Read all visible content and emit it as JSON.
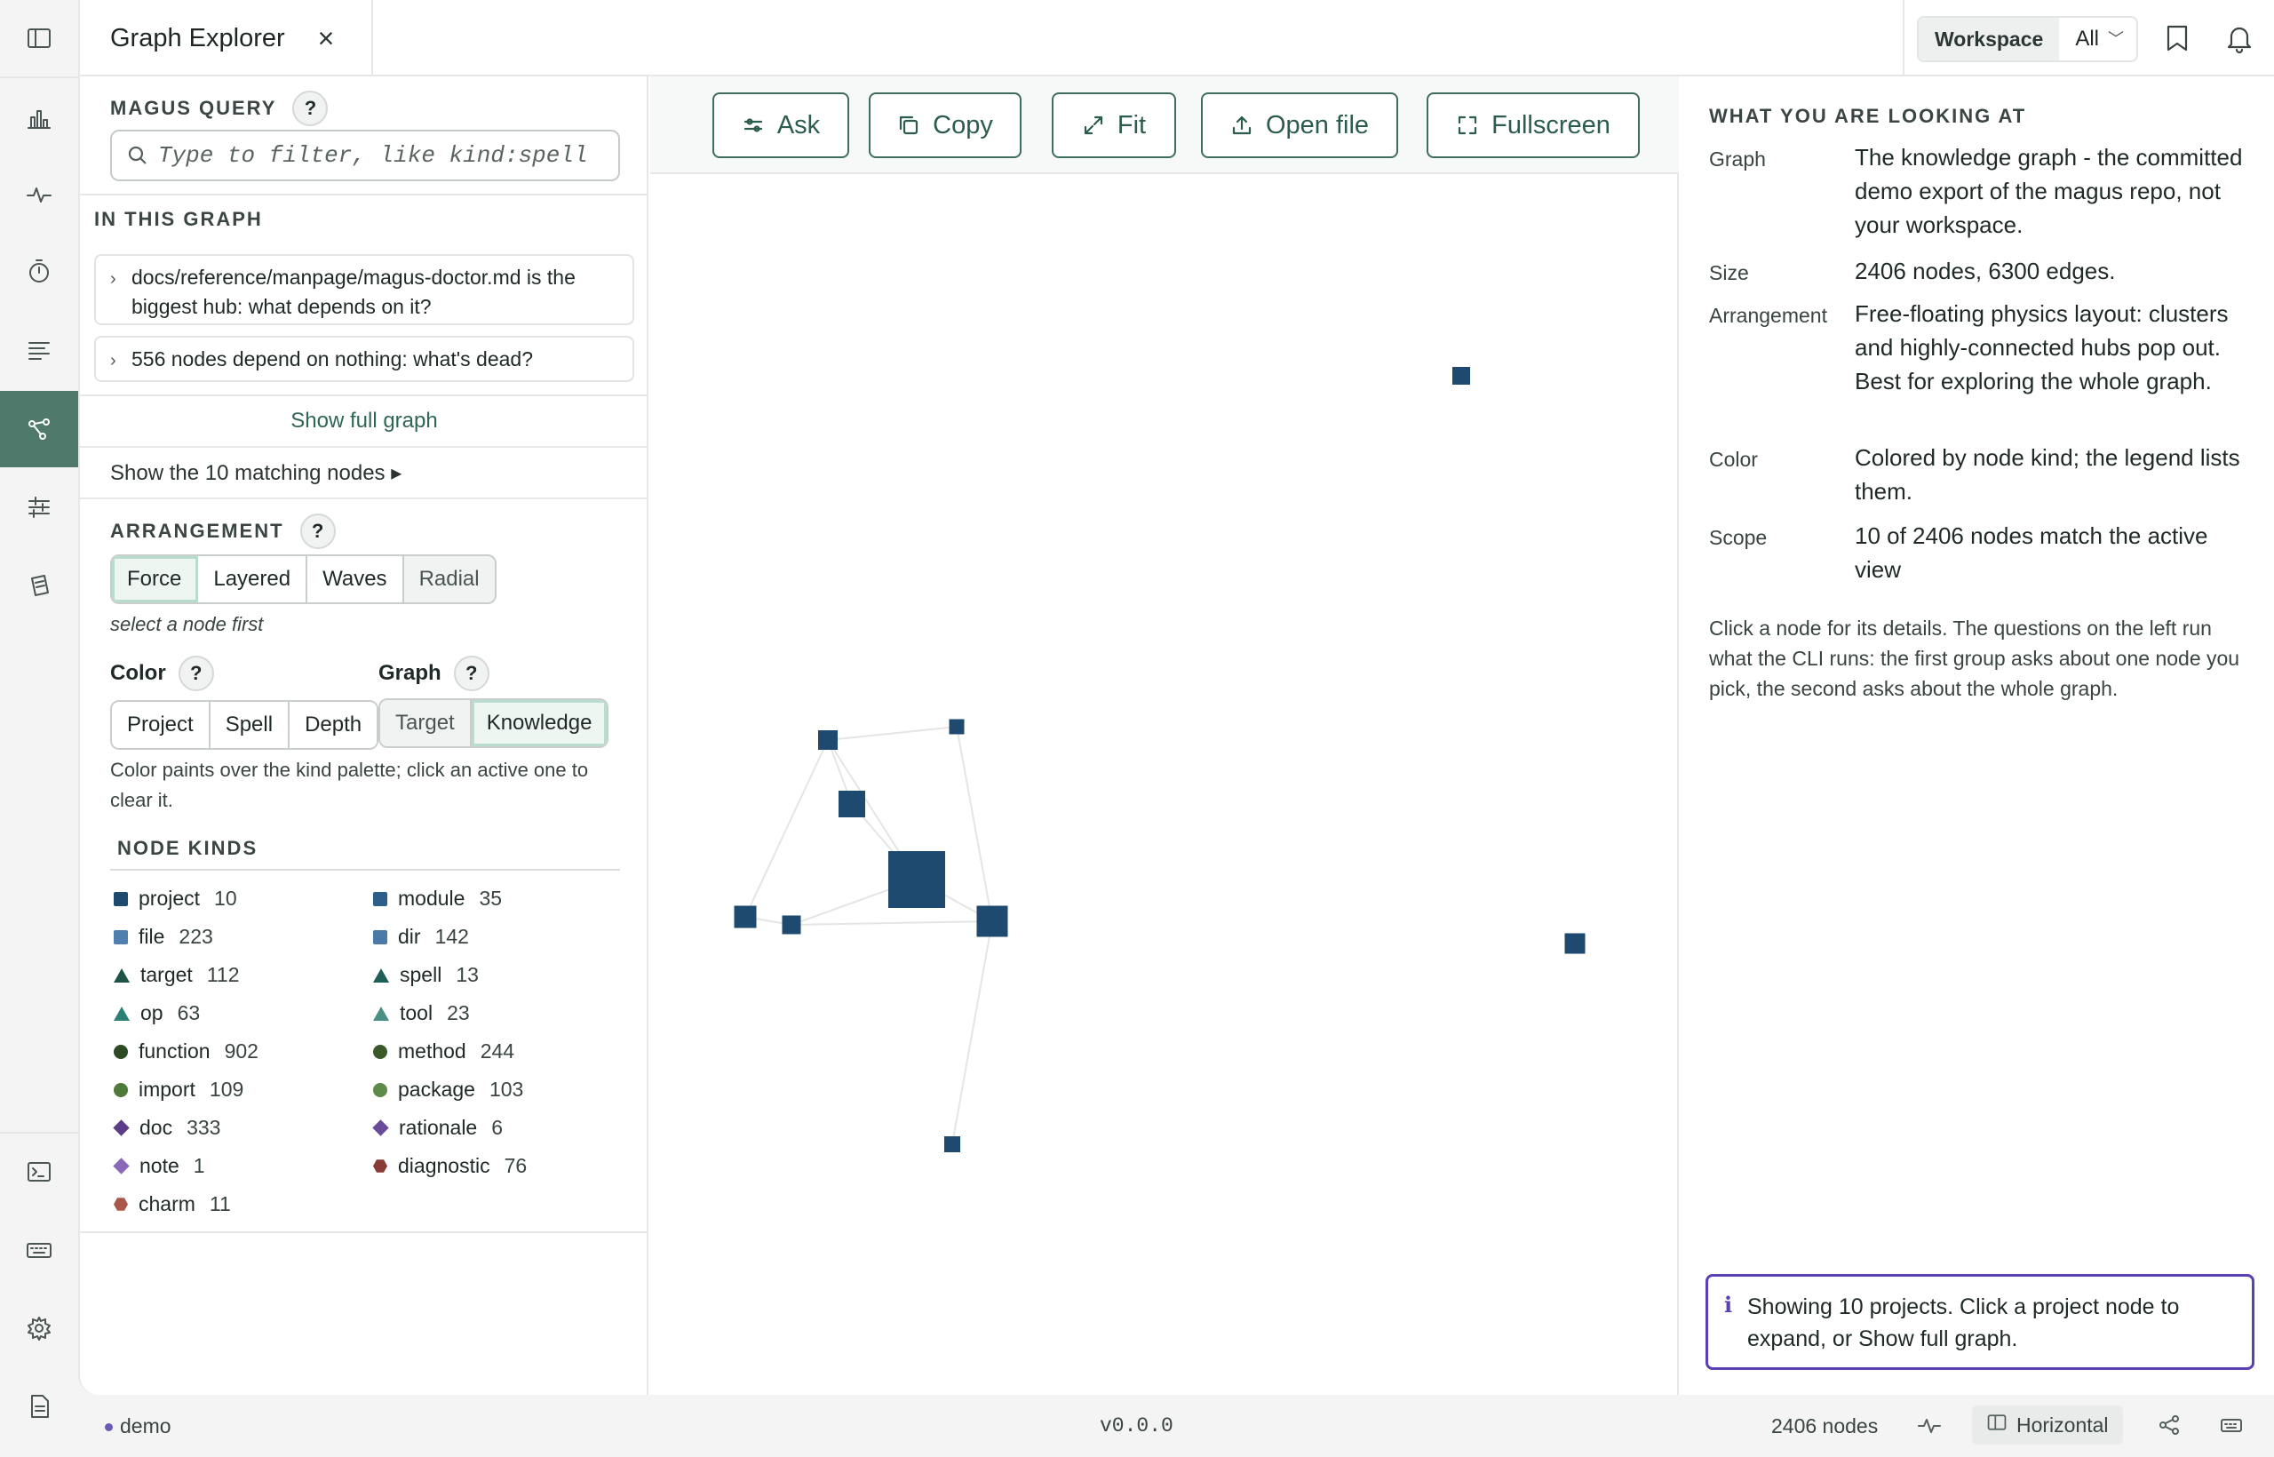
{
  "tab": {
    "title": "Graph Explorer",
    "close": "×"
  },
  "workspace": {
    "label": "Workspace",
    "value": "All",
    "chevron": "﹀"
  },
  "query": {
    "title": "MAGUS QUERY",
    "help": "?",
    "placeholder": "Type to filter, like kind:spell"
  },
  "in_graph": {
    "title": "IN THIS GRAPH",
    "suggestions": [
      "docs/reference/manpage/magus-doctor.md is the biggest hub: what depends on it?",
      "556 nodes depend on nothing: what's dead?"
    ],
    "show_full": "Show full graph",
    "show_matching": "Show the 10 matching nodes ▸"
  },
  "arrangement": {
    "title": "ARRANGEMENT",
    "help": "?",
    "options": [
      "Force",
      "Layered",
      "Waves",
      "Radial"
    ],
    "active": "Force",
    "hint": "select a node first"
  },
  "color": {
    "title": "Color",
    "help": "?",
    "options": [
      "Project",
      "Spell",
      "Depth"
    ]
  },
  "graph_mode": {
    "title": "Graph",
    "help": "?",
    "options": [
      "Target",
      "Knowledge"
    ],
    "active": "Knowledge"
  },
  "color_note": "Color paints over the kind palette; click an active one to clear it.",
  "node_kinds": {
    "title": "NODE KINDS",
    "items": [
      {
        "name": "project",
        "count": "10",
        "shape": "square",
        "color": "#1d4a6e"
      },
      {
        "name": "module",
        "count": "35",
        "shape": "square",
        "color": "#2c5f8a"
      },
      {
        "name": "file",
        "count": "223",
        "shape": "square",
        "color": "#4f7fae"
      },
      {
        "name": "dir",
        "count": "142",
        "shape": "square",
        "color": "#4a7aa8"
      },
      {
        "name": "target",
        "count": "112",
        "shape": "triangle",
        "color": "#1e5448"
      },
      {
        "name": "spell",
        "count": "13",
        "shape": "triangle",
        "color": "#1e5f58"
      },
      {
        "name": "op",
        "count": "63",
        "shape": "triangle",
        "color": "#2e8077"
      },
      {
        "name": "tool",
        "count": "23",
        "shape": "triangle",
        "color": "#4a8f86"
      },
      {
        "name": "function",
        "count": "902",
        "shape": "circle",
        "color": "#2e4a23"
      },
      {
        "name": "method",
        "count": "244",
        "shape": "circle",
        "color": "#3b5a2c"
      },
      {
        "name": "import",
        "count": "109",
        "shape": "circle",
        "color": "#4f7a3a"
      },
      {
        "name": "package",
        "count": "103",
        "shape": "circle",
        "color": "#5e8a4a"
      },
      {
        "name": "doc",
        "count": "333",
        "shape": "diamond",
        "color": "#5a3d86"
      },
      {
        "name": "rationale",
        "count": "6",
        "shape": "diamond",
        "color": "#6a4a9a"
      },
      {
        "name": "note",
        "count": "1",
        "shape": "diamond",
        "color": "#8a6ab8"
      },
      {
        "name": "diagnostic",
        "count": "76",
        "shape": "hexagon",
        "color": "#8a3a34"
      },
      {
        "name": "charm",
        "count": "11",
        "shape": "hexagon",
        "color": "#a9574a"
      }
    ]
  },
  "toolbar": {
    "ask": "Ask",
    "copy": "Copy",
    "fit": "Fit",
    "open_file": "Open file",
    "fullscreen": "Fullscreen"
  },
  "graph": {
    "node_color": "#1d4a6e",
    "edge_color": "#e3e6e5"
  },
  "info": {
    "title": "WHAT YOU ARE LOOKING AT",
    "rows": [
      {
        "key": "Graph",
        "value": "The knowledge graph - the committed demo export of the magus repo, not your workspace."
      },
      {
        "key": "Size",
        "value": "2406 nodes, 6300 edges."
      },
      {
        "key": "Arrangement",
        "value": "Free-floating physics layout: clusters and highly-connected hubs pop out. Best for exploring the whole graph."
      },
      {
        "key": "Color",
        "value": "Colored by node kind; the legend lists them."
      },
      {
        "key": "Scope",
        "value": "10 of 2406 nodes match the active view"
      }
    ],
    "paragraph": "Click a node for its details. The questions on the left run what the CLI runs: the first group asks about one node you pick, the second asks about the whole graph.",
    "notice": "Showing 10 projects. Click a project node to expand, or Show full graph.",
    "notice_icon": "i"
  },
  "status": {
    "workspace": "demo",
    "version": "v0.0.0",
    "nodes": "2406 nodes",
    "layout": "Horizontal"
  }
}
